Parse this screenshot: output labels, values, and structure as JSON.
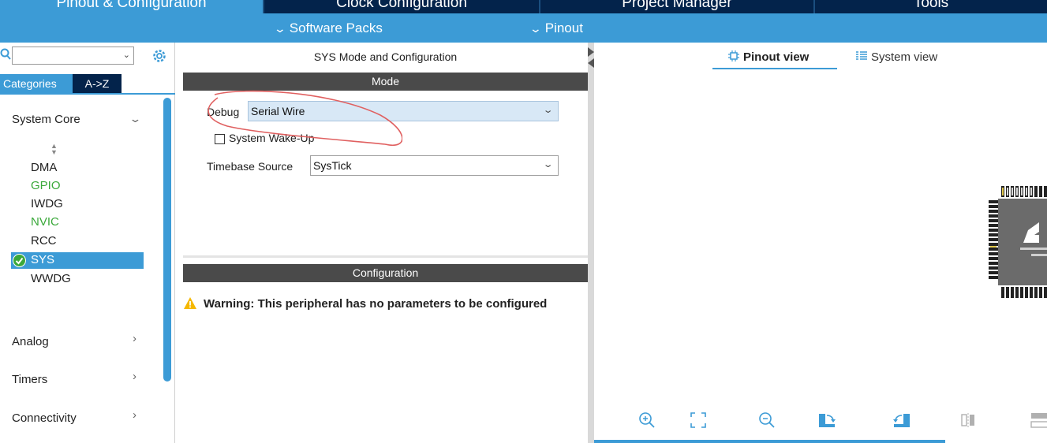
{
  "top_tabs": [
    {
      "label": "Pinout & Configuration",
      "active": true
    },
    {
      "label": "Clock Configuration",
      "active": false
    },
    {
      "label": "Project Manager",
      "active": false
    },
    {
      "label": "Tools",
      "active": false
    }
  ],
  "sub_menu": {
    "software_packs": "Software Packs",
    "pinout": "Pinout"
  },
  "left_panel": {
    "search_value": "",
    "tabs": {
      "categories": "Categories",
      "az": "A->Z"
    },
    "system_core": {
      "label": "System Core",
      "items": [
        {
          "label": "DMA",
          "state": "normal"
        },
        {
          "label": "GPIO",
          "state": "configured"
        },
        {
          "label": "IWDG",
          "state": "normal"
        },
        {
          "label": "NVIC",
          "state": "configured"
        },
        {
          "label": "RCC",
          "state": "normal"
        },
        {
          "label": "SYS",
          "state": "selected"
        },
        {
          "label": "WWDG",
          "state": "normal"
        }
      ]
    },
    "groups": [
      {
        "label": "Analog"
      },
      {
        "label": "Timers"
      },
      {
        "label": "Connectivity"
      }
    ]
  },
  "middle_panel": {
    "title": "SYS Mode and Configuration",
    "mode_header": "Mode",
    "debug": {
      "label": "Debug",
      "value": "Serial Wire"
    },
    "wakeup": {
      "label": "System Wake-Up",
      "checked": false
    },
    "timebase": {
      "label": "Timebase Source",
      "value": "SysTick"
    },
    "config_header": "Configuration",
    "warning": "Warning: This peripheral has no parameters to be configured"
  },
  "right_panel": {
    "tabs": {
      "pinout": "Pinout view",
      "system": "System view"
    }
  },
  "colors": {
    "nav_dark": "#03234b",
    "accent_blue": "#3c9bd6",
    "header_gray": "#4a4a4a",
    "configured_green": "#3aa83a",
    "annotation_red": "#e06060"
  },
  "icons": [
    "search-icon",
    "gear-icon",
    "check-icon",
    "warning-icon",
    "zoom-in-icon",
    "fit-screen-icon",
    "zoom-out-icon",
    "rotate-right-icon",
    "rotate-left-icon",
    "flip-horizontal-icon",
    "flip-vertical-icon"
  ]
}
